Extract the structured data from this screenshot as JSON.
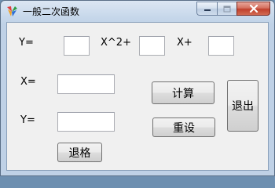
{
  "window": {
    "title": "一般二次函数",
    "icon": "colorful-app-icon"
  },
  "caption_buttons": {
    "minimize_icon": "minimize-icon",
    "maximize_icon": "maximize-icon",
    "close_icon": "close-icon"
  },
  "form": {
    "y_label": "Y=",
    "x_squared_label": "X^2+",
    "x_plus_label": "X+",
    "a_value": "",
    "b_value": "",
    "c_value": "",
    "x_label": "X=",
    "x_value": "",
    "y_result_label": "Y=",
    "y_value": ""
  },
  "buttons": {
    "calculate": "计算",
    "reset": "重设",
    "exit": "退出",
    "backspace": "退格"
  },
  "colors": {
    "close_button": "#c0402c",
    "client_background": "#f0f0f0"
  }
}
